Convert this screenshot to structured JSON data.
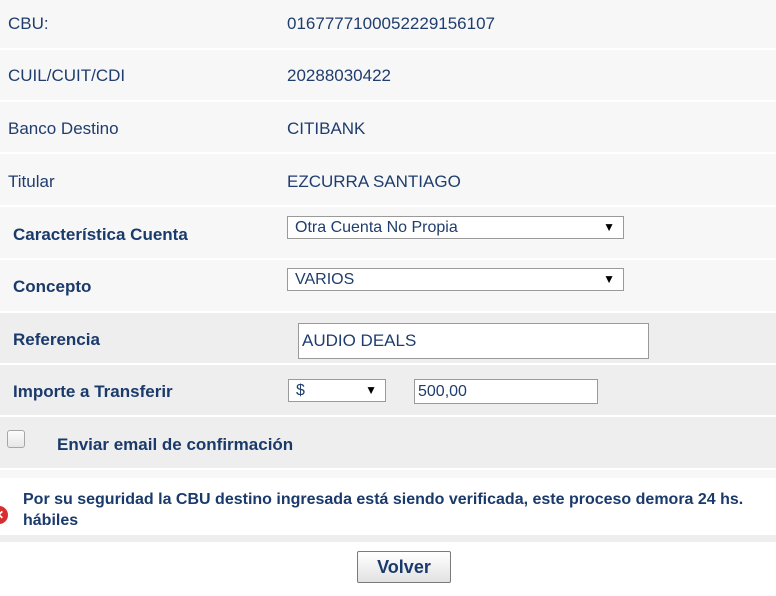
{
  "rows": {
    "cbu": {
      "label": "CBU:",
      "value": "0167777100052229156107"
    },
    "cuil": {
      "label": "CUIL/CUIT/CDI",
      "value": "20288030422"
    },
    "banco": {
      "label": "Banco Destino",
      "value": "CITIBANK"
    },
    "titular": {
      "label": "Titular",
      "value": "EZCURRA SANTIAGO"
    }
  },
  "form": {
    "caracteristica": {
      "label": "Característica Cuenta",
      "selected": "Otra Cuenta No Propia"
    },
    "concepto": {
      "label": "Concepto",
      "selected": "VARIOS"
    },
    "referencia": {
      "label": "Referencia",
      "value": "AUDIO DEALS"
    },
    "importe": {
      "label": "Importe a Transferir",
      "currency": "$",
      "amount": "500,00"
    },
    "email_confirm": {
      "label": "Enviar email de confirmación",
      "checked": false
    }
  },
  "alert": {
    "icon": "error-icon",
    "text": "Por su seguridad la CBU destino ingresada está siendo verificada, este proceso demora 24 hs. hábiles"
  },
  "actions": {
    "back_label": "Volver"
  },
  "colors": {
    "text": "#1f3d6e",
    "row_bg_light": "#f7f7f7",
    "row_bg_mid": "#eeeeee",
    "alert": "#d82d2d"
  }
}
